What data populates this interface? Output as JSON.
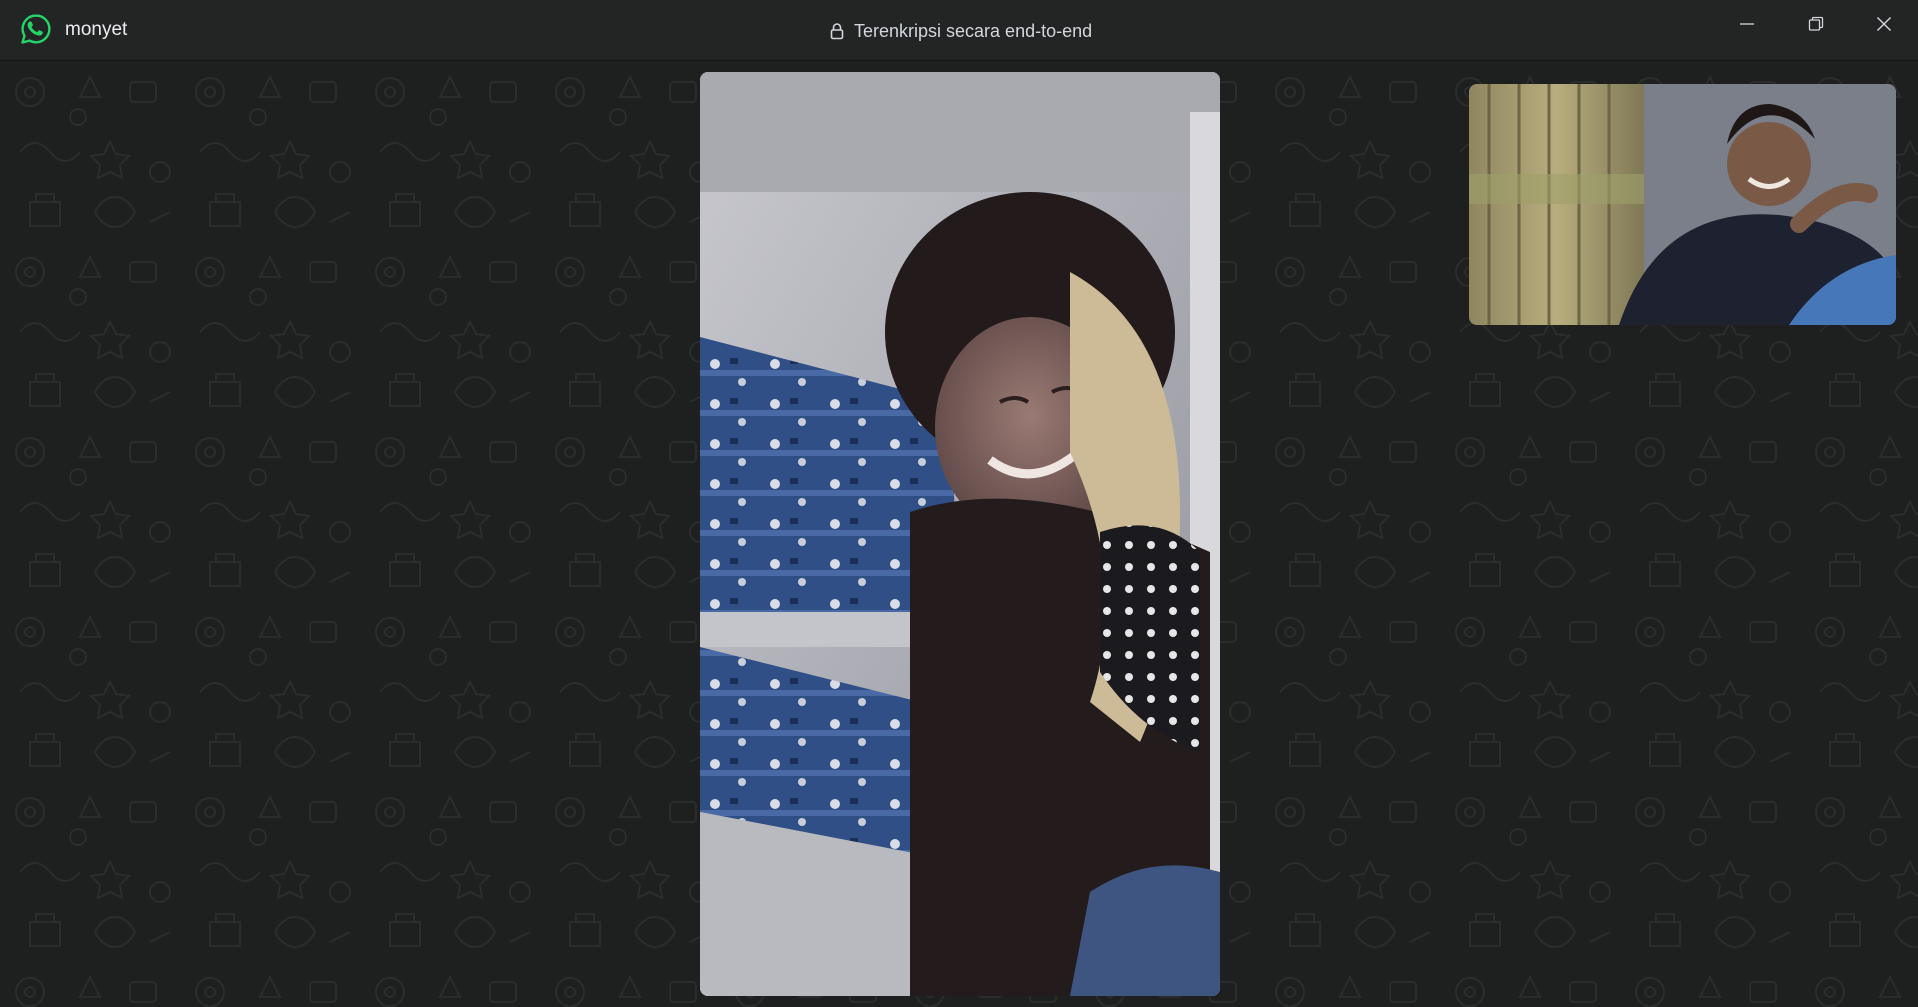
{
  "window": {
    "contact_name": "monyet",
    "encryption_label": "Terenkripsi secara end-to-end",
    "controls": [
      "minimize-icon",
      "restore-icon",
      "close-icon"
    ]
  },
  "icons": {
    "app_logo": "whatsapp-logo-icon",
    "encryption": "lock-icon"
  },
  "colors": {
    "titlebar_bg": "#232424",
    "call_bg": "#1e1f1f",
    "brand_green": "#25d366",
    "text": "#e9edef"
  },
  "call": {
    "remote_video": "remote-participant-video",
    "self_video": "self-preview-video"
  }
}
